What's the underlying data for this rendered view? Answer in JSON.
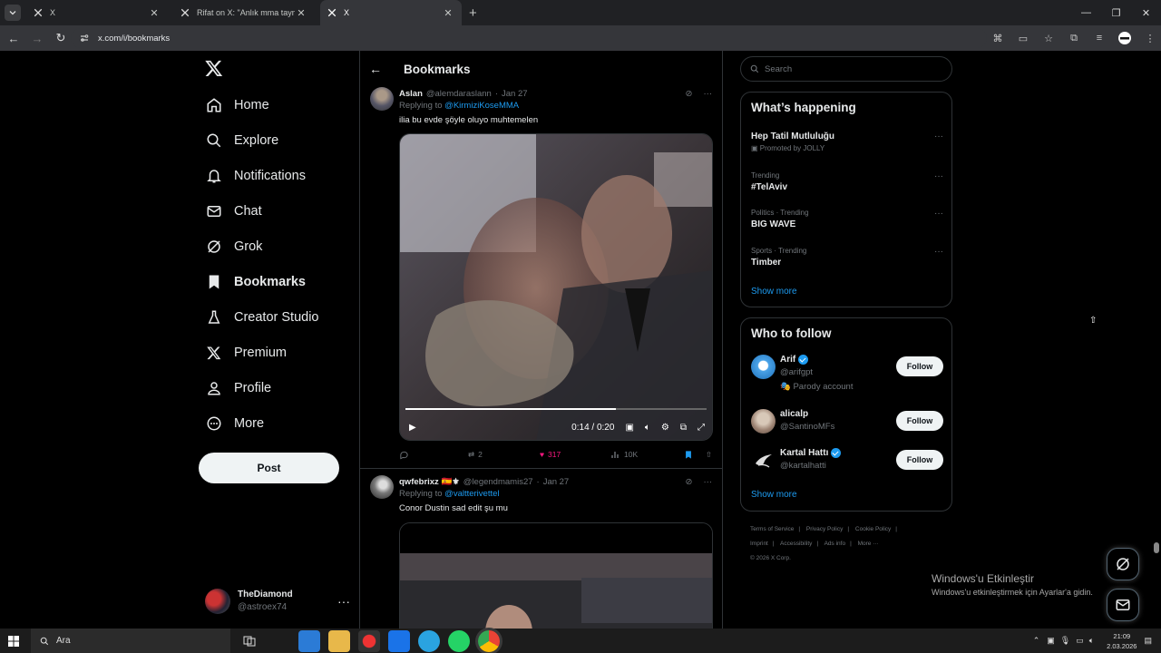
{
  "browser": {
    "tabs": [
      {
        "title": "X"
      },
      {
        "title": "Rifat on X: \"Anlık mma taymı h.."
      },
      {
        "title": "X"
      }
    ],
    "url": "x.com/i/bookmarks"
  },
  "nav": {
    "items": [
      {
        "label": "Home",
        "icon": "home-icon"
      },
      {
        "label": "Explore",
        "icon": "search-icon"
      },
      {
        "label": "Notifications",
        "icon": "bell-icon"
      },
      {
        "label": "Chat",
        "icon": "mail-icon"
      },
      {
        "label": "Grok",
        "icon": "grok-icon"
      },
      {
        "label": "Bookmarks",
        "icon": "bookmark-icon"
      },
      {
        "label": "Creator Studio",
        "icon": "creator-icon"
      },
      {
        "label": "Premium",
        "icon": "x-icon"
      },
      {
        "label": "Profile",
        "icon": "person-icon"
      },
      {
        "label": "More",
        "icon": "more-circle-icon"
      }
    ],
    "post_label": "Post",
    "account": {
      "name": "TheDiamond",
      "handle": "@astroex74"
    }
  },
  "main": {
    "title": "Bookmarks",
    "tweets": [
      {
        "name": "Aslan",
        "handle": "@alemdaraslann",
        "date": "Jan 27",
        "replying_prefix": "Replying to",
        "replying_to": "@KirmiziKoseMMA",
        "text": "ilia bu evde şöyle oluyo muhtemelen",
        "video": {
          "time": "0:14 / 0:20",
          "progress": 0.7
        },
        "stats": {
          "replies": "",
          "reposts": "2",
          "likes": "317",
          "views": "10K"
        }
      },
      {
        "name": "qwfebrixz 🇪🇸⚜",
        "handle": "@legendmamis27",
        "date": "Jan 27",
        "replying_prefix": "Replying to",
        "replying_to": "@valtterivettel",
        "text": "Conor Dustin sad edit şu mu"
      }
    ]
  },
  "right": {
    "search_placeholder": "Search",
    "happening": {
      "title": "What’s happening",
      "trends": [
        {
          "meta": "Promoted by JOLLY",
          "title": "Hep Tatil Mutluluğu",
          "promoted": true
        },
        {
          "meta": "Trending",
          "title": "#TelAviv"
        },
        {
          "meta": "Politics · Trending",
          "title": "BIG WAVE"
        },
        {
          "meta": "Sports · Trending",
          "title": "Timber"
        }
      ],
      "show_more": "Show more"
    },
    "who_to_follow": {
      "title": "Who to follow",
      "users": [
        {
          "name": "Arif",
          "handle": "@arifgpt",
          "sub": "🎭 Parody account",
          "verified": true,
          "follow": "Follow"
        },
        {
          "name": "alicalp",
          "handle": "@SantinoMFs",
          "verified": false,
          "follow": "Follow"
        },
        {
          "name": "Kartal Hattı",
          "handle": "@kartalhatti",
          "verified": true,
          "follow": "Follow"
        }
      ],
      "show_more": "Show more"
    },
    "footer": [
      "Terms of Service",
      "|",
      "Privacy Policy",
      "|",
      "Cookie Policy",
      "|",
      "Imprint",
      "|",
      "Accessibility",
      "|",
      "Ads info",
      "|",
      "More ···",
      "© 2026 X Corp."
    ]
  },
  "windows": {
    "activate_title": "Windows'u Etkinleştir",
    "activate_sub": "Windows'u etkinleştirmek için Ayarlar'a gidin.",
    "search_label": "Ara",
    "time": "21:09",
    "date": "2.03.2026"
  },
  "colors": {
    "accent": "#1d9bf0",
    "like": "#f91880",
    "bg": "#000000",
    "border": "#2f3336"
  }
}
